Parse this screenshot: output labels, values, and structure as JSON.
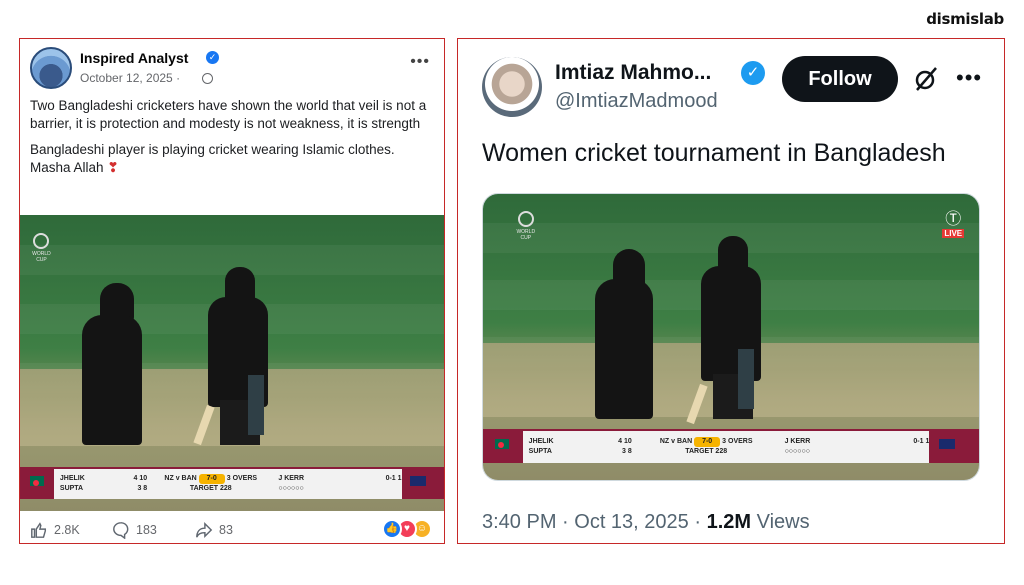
{
  "brand": "dismislab",
  "facebook_post": {
    "author": "Inspired Analyst",
    "date": "October 12, 2025",
    "date_separator": "·",
    "text_1": "Two Bangladeshi cricketers have shown the world that veil is not a barrier, it is protection and modesty is not weakness, it is strength",
    "text_2": "Bangladeshi player is playing cricket wearing Islamic clothes. Masha Allah",
    "likes": "2.8K",
    "comments": "183",
    "shares": "83"
  },
  "tweet": {
    "name": "Imtiaz Mahmo...",
    "handle": "@ImtiazMadmood",
    "follow_label": "Follow",
    "text": "Women cricket tournament in Bangladesh",
    "time": "3:40 PM",
    "date": "Oct 13, 2025",
    "views_count": "1.2M",
    "views_label": "Views"
  },
  "scoreboard": {
    "batter_1": "JHELIK",
    "batter_1_stats": "4 10",
    "batter_2": "SUPTA",
    "batter_2_stats": "3 8",
    "match": "NZ v BAN",
    "score": "7-0",
    "overs": "3 OVERS",
    "target": "TARGET 228",
    "bowler": "J KERR",
    "bowler_figures": "0-1 1",
    "balls": "○○○○○○"
  },
  "colors": {
    "frame_border": "#c62828",
    "fb_verified": "#1877f2",
    "tw_verified": "#1d9bf0",
    "follow_bg": "#0f1419",
    "score_highlight": "#f6b300"
  }
}
